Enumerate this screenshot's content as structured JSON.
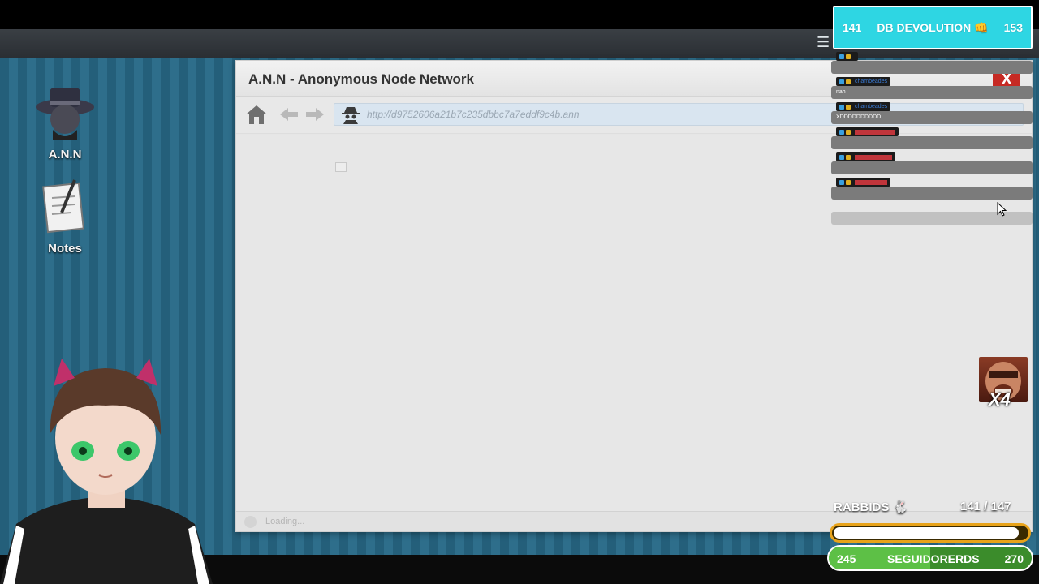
{
  "desktop": {
    "icons": [
      {
        "label": "A.N.N",
        "icon": "hacker-hat-icon"
      },
      {
        "label": "Notes",
        "icon": "notepad-icon"
      }
    ]
  },
  "browser": {
    "title": "A.N.N - Anonymous Node Network",
    "close_label": "X",
    "url": "http://d9752606a21b7c235dbbc7a7eddf9c4b.ann",
    "status": "Loading..."
  },
  "overlay": {
    "top_widget": {
      "left": "141",
      "label": "DB DEVOLUTION 👊",
      "right": "153"
    },
    "chat": [
      {
        "user": "",
        "text": "",
        "user_color": "#c0353b"
      },
      {
        "user": "chambeades",
        "text": "nah",
        "user_color": "#3a7bd5"
      },
      {
        "user": "chambeades",
        "text": "XDDDDDDDDDD",
        "user_color": "#3a7bd5"
      },
      {
        "user": "",
        "text": "",
        "user_color": "#c0353b"
      },
      {
        "user": "",
        "text": "",
        "user_color": "#c0353b"
      },
      {
        "user": "",
        "text": "",
        "user_color": "#c0353b"
      }
    ],
    "emote_multiplier": "X4",
    "rabbids": {
      "label": "RABBIDS 🐇",
      "count": "141  / 147",
      "progress": 0.96
    },
    "followers": {
      "left": "245",
      "label": "SEGUIDORERDS",
      "right": "270",
      "progress": 0.5
    }
  },
  "colors": {
    "accent_cyan": "#2ed6e3",
    "follower_green": "#5dc046",
    "close_red": "#c62a24"
  }
}
